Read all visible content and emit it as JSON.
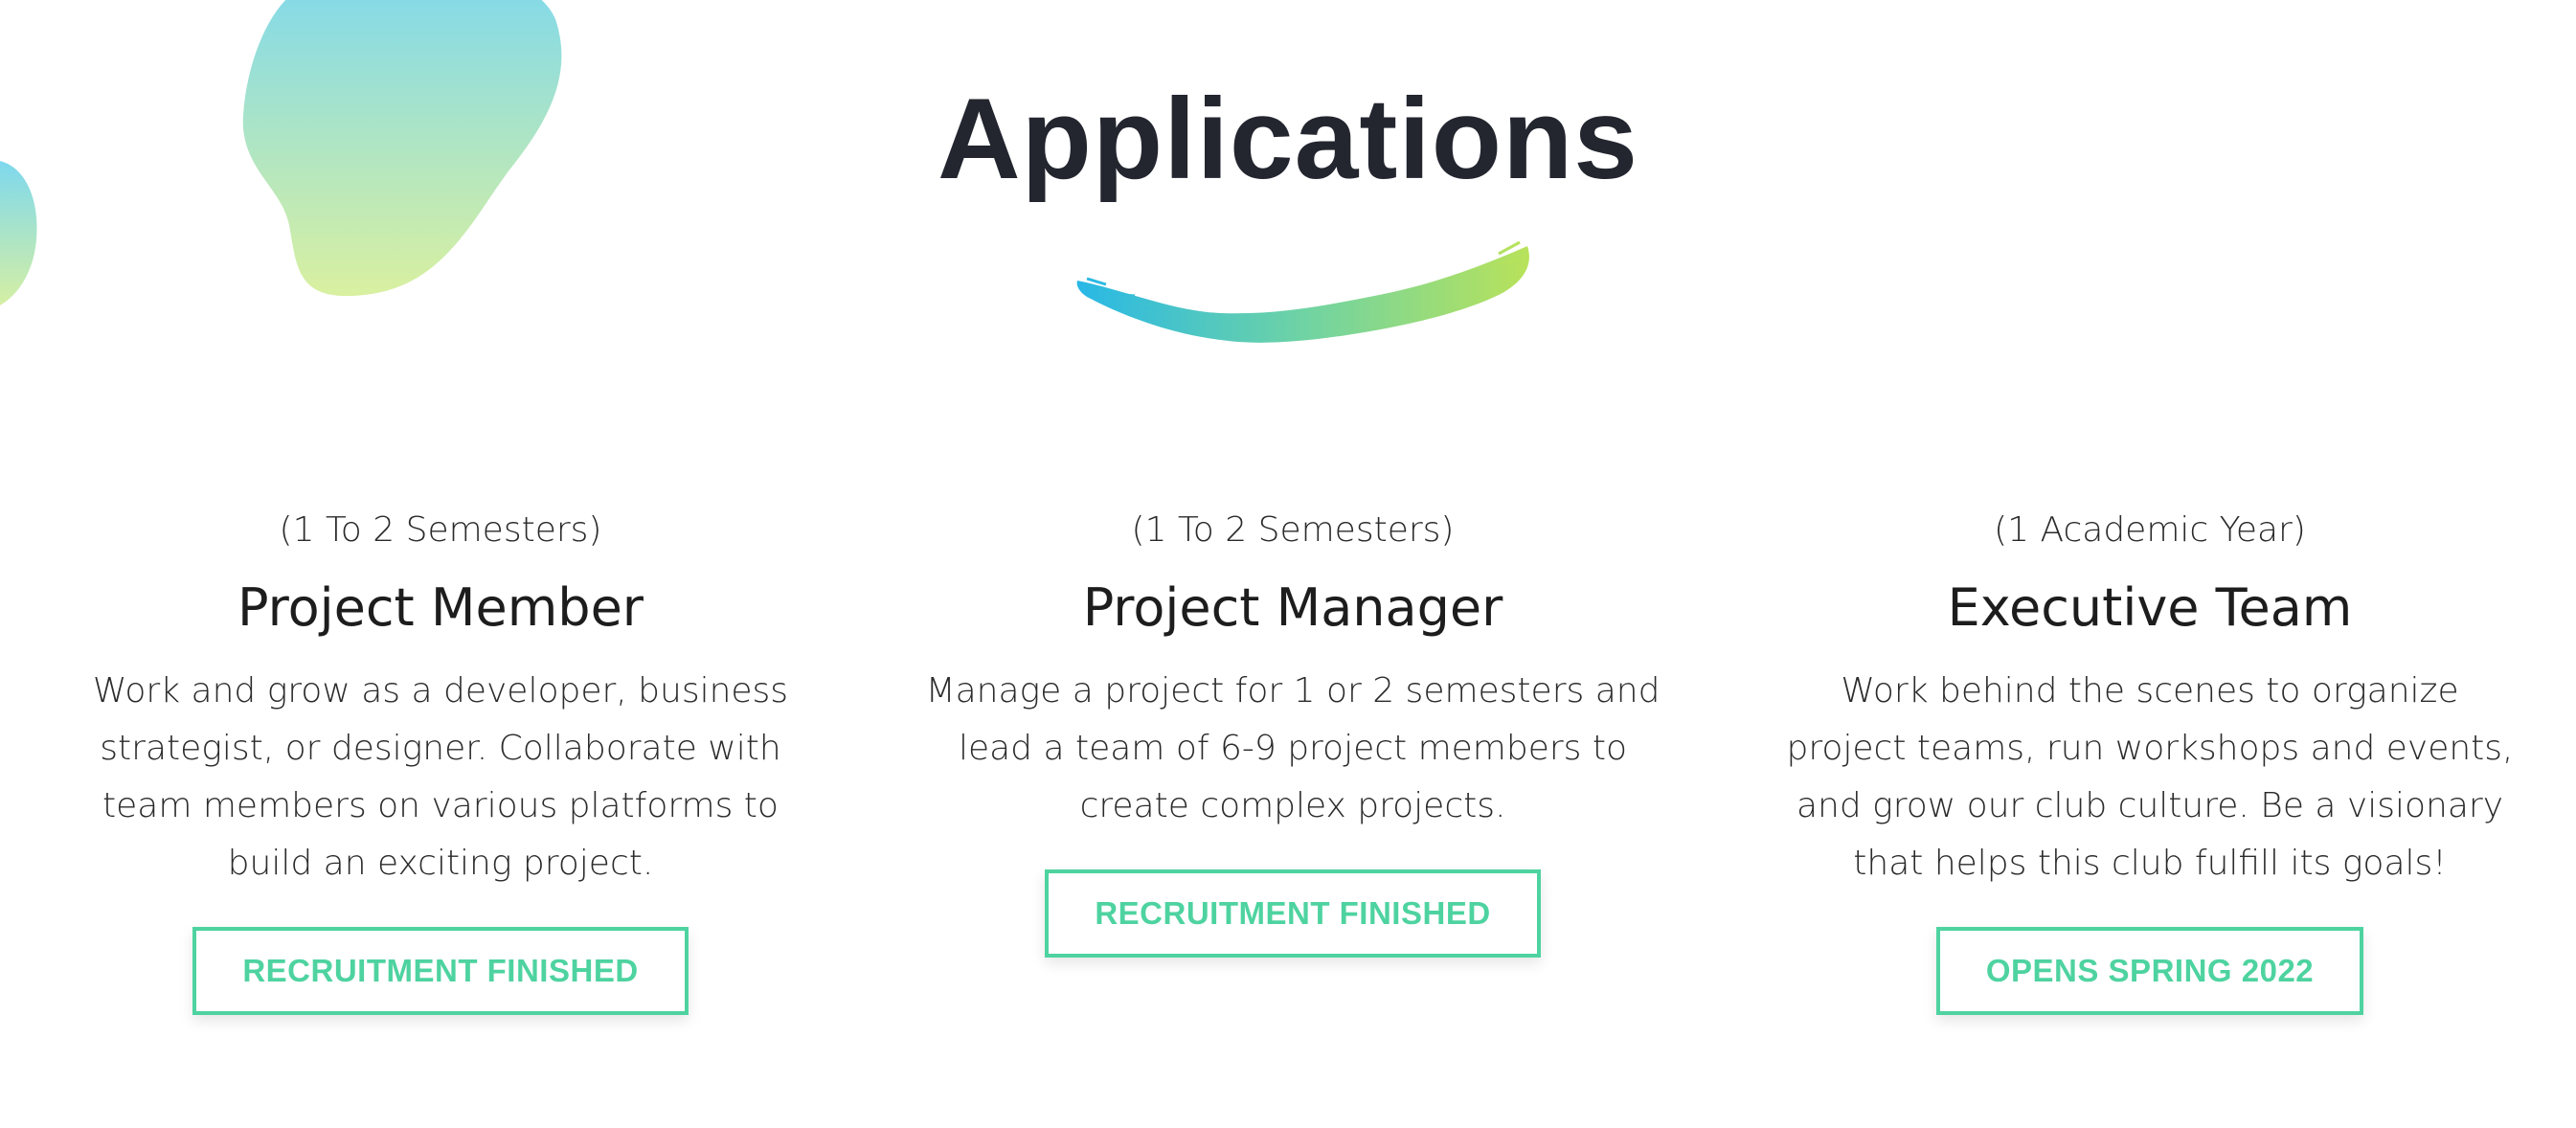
{
  "section": {
    "title": "Applications"
  },
  "colors": {
    "accent": "#4ed3a0",
    "heading": "#23262f",
    "blob_top": "#7dd8ee",
    "blob_bottom": "#d9f0a0",
    "brush_start": "#28b8e6",
    "brush_end": "#b8e25a"
  },
  "cards": [
    {
      "duration": "(1 To 2 Semesters)",
      "role": "Project Member",
      "description": "Work and grow as a developer, business strategist, or designer. Collaborate with team members on various platforms to build an exciting project.",
      "button": "RECRUITMENT FINISHED"
    },
    {
      "duration": "(1 To 2 Semesters)",
      "role": "Project Manager",
      "description": "Manage a project for 1 or 2 semesters and lead a team of 6-9 project members to create complex projects.",
      "button": "RECRUITMENT FINISHED"
    },
    {
      "duration": "(1 Academic Year)",
      "role": "Executive Team",
      "description": "Work behind the scenes to organize project teams, run workshops and events, and grow our club culture. Be a visionary that helps this club fulfill its goals!",
      "button": "OPENS SPRING 2022"
    }
  ]
}
